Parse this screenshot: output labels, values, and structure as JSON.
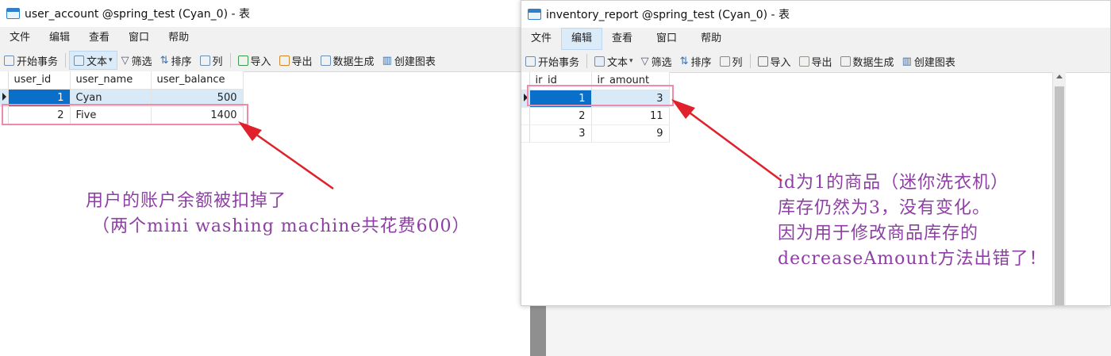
{
  "left_window": {
    "title": "user_account @spring_test (Cyan_0) - 表",
    "menu": [
      "文件",
      "编辑",
      "查看",
      "窗口",
      "帮助"
    ],
    "toolbar": {
      "begin_transaction": "开始事务",
      "text": "文本",
      "filter": "筛选",
      "sort": "排序",
      "columns": "列",
      "import": "导入",
      "export": "导出",
      "data_generate": "数据生成",
      "create_chart": "创建图表"
    },
    "table": {
      "columns": [
        "user_id",
        "user_name",
        "user_balance"
      ],
      "rows": [
        [
          "1",
          "Cyan",
          "500"
        ],
        [
          "2",
          "Five",
          "1400"
        ]
      ]
    }
  },
  "right_window": {
    "title": "inventory_report @spring_test (Cyan_0) - 表",
    "menu": [
      "文件",
      "编辑",
      "查看",
      "窗口",
      "帮助"
    ],
    "toolbar": {
      "begin_transaction": "开始事务",
      "text": "文本",
      "filter": "筛选",
      "sort": "排序",
      "columns": "列",
      "import": "导入",
      "export": "导出",
      "data_generate": "数据生成",
      "create_chart": "创建图表"
    },
    "table": {
      "columns": [
        "ir_id",
        "ir_amount"
      ],
      "rows": [
        [
          "1",
          "3"
        ],
        [
          "2",
          "11"
        ],
        [
          "3",
          "9"
        ]
      ]
    }
  },
  "annotations": {
    "left_line1": "用户的账户余额被扣掉了",
    "left_line2": "（两个mini washing machine共花费600）",
    "right_line1": "id为1的商品（迷你洗衣机）",
    "right_line2": "库存仍然为3，没有变化。",
    "right_line3": "因为用于修改商品库存的",
    "right_line4": "decreaseAmount方法出错了！"
  },
  "colors": {
    "annotation_text": "#8e3fa4",
    "highlight_box": "#f08aa8",
    "arrow": "#e0212b",
    "selected_cell": "#0a6fc9"
  }
}
